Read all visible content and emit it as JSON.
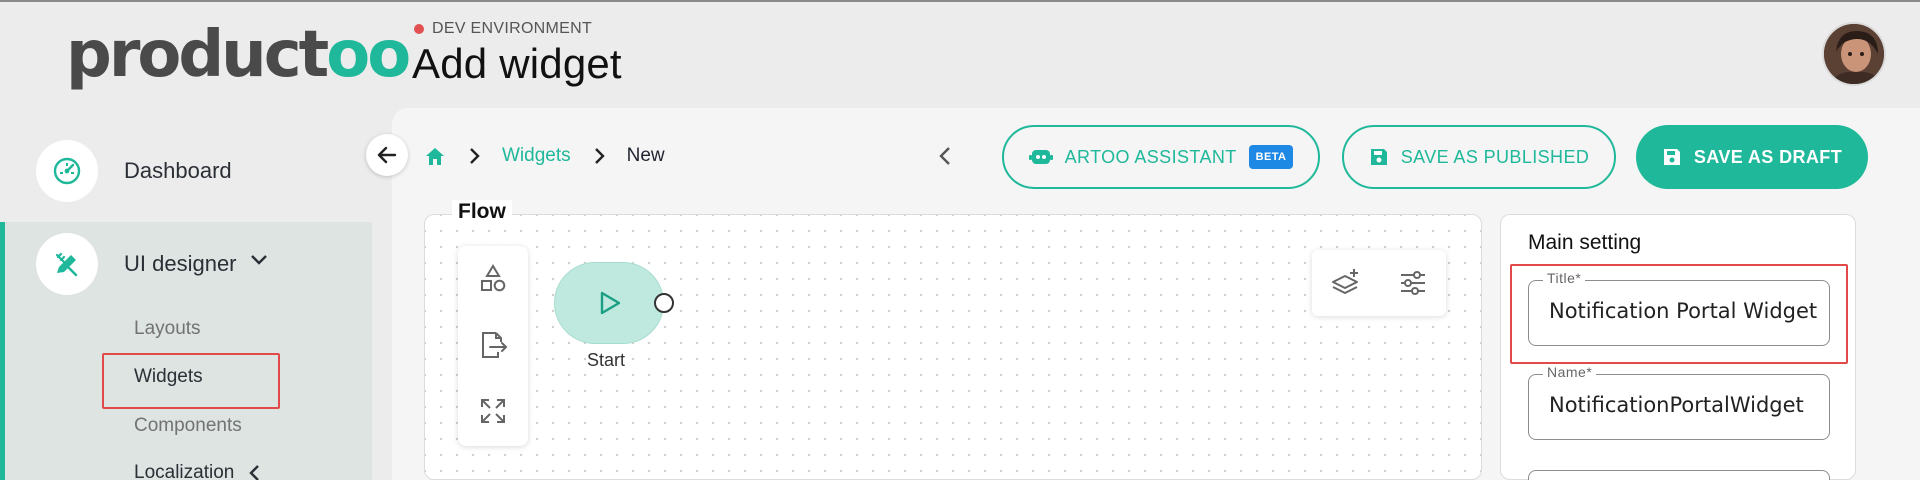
{
  "logo": {
    "main": "product",
    "accent": "oo"
  },
  "header": {
    "environment": "DEV ENVIRONMENT",
    "title": "Add widget"
  },
  "sidebar": {
    "items": [
      {
        "label": "Dashboard"
      },
      {
        "label": "UI designer"
      }
    ],
    "subitems": [
      {
        "label": "Layouts"
      },
      {
        "label": "Widgets"
      },
      {
        "label": "Components"
      },
      {
        "label": "Localization"
      }
    ]
  },
  "breadcrumb": {
    "section": "Widgets",
    "current": "New"
  },
  "toolbar": {
    "assistant_label": "ARTOO ASSISTANT",
    "beta_label": "BETA",
    "publish_label": "SAVE AS PUBLISHED",
    "draft_label": "SAVE AS DRAFT"
  },
  "flow": {
    "title": "Flow",
    "start_label": "Start"
  },
  "settings": {
    "title": "Main setting",
    "fields": [
      {
        "label": "Title*",
        "value": "Notification Portal Widget"
      },
      {
        "label": "Name*",
        "value": "NotificationPortalWidget"
      }
    ]
  },
  "colors": {
    "accent": "#1fb89a",
    "env_dot": "#e25151",
    "beta": "#1e88e5",
    "highlight": "#e24a4a"
  }
}
